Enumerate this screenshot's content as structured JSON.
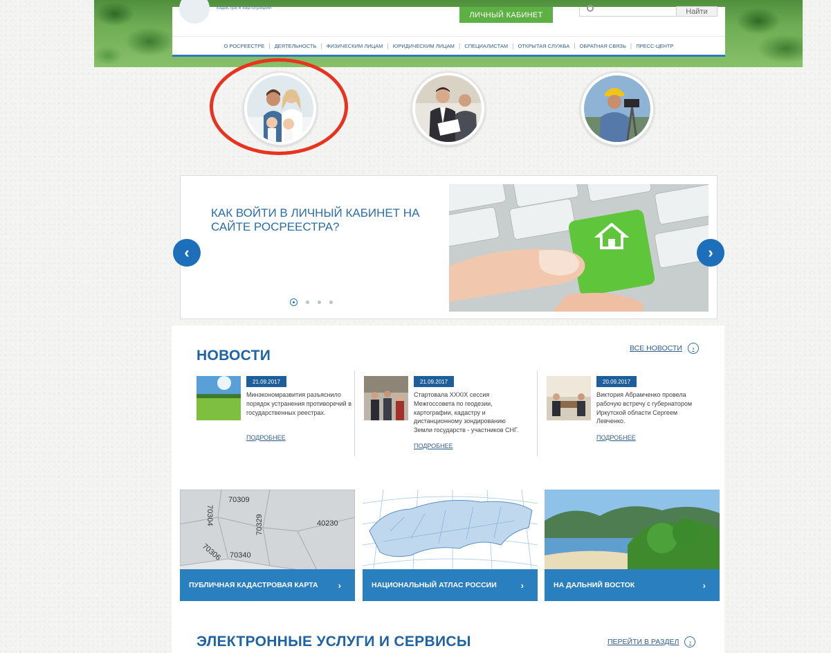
{
  "header": {
    "logo_subtitle": "кадастра и картографии",
    "cabinet_button": "ЛИЧНЫЙ КАБИНЕТ",
    "search_button": "Найти",
    "nav": [
      "О РОСРЕЕСТРЕ",
      "ДЕЯТЕЛЬНОСТЬ",
      "ФИЗИЧЕСКИМ ЛИЦАМ",
      "ЮРИДИЧЕСКИМ ЛИЦАМ",
      "СПЕЦИАЛИСТАМ",
      "ОТКРЫТАЯ СЛУЖБА",
      "ОБРАТНАЯ СВЯЗЬ",
      "ПРЕСС-ЦЕНТР"
    ]
  },
  "slider": {
    "title": "КАК ВОЙТИ В ЛИЧНЫЙ КАБИНЕТ НА САЙТЕ РОСРЕЕСТРА?",
    "prev": "‹",
    "next": "›"
  },
  "news": {
    "title": "НОВОСТИ",
    "all_link": "ВСЕ НОВОСТИ",
    "items": [
      {
        "date": "21.09.2017",
        "text": "Минэкономразвития разъяснило порядок устранения противоречий в государственных реестрах.",
        "more": "ПОДРОБНЕЕ"
      },
      {
        "date": "21.09.2017",
        "text": "Стартовала XXXIX сессия Межгоссовета по геодезии, картографии, кадастру и дистанционному зондированию Земли государств - участников СНГ.",
        "more": "ПОДРОБНЕЕ"
      },
      {
        "date": "20.09.2017",
        "text": "Виктория Абрамченко провела рабочую встречу с губернатором Иркутской области Сергеем Левченко.",
        "more": "ПОДРОБНЕЕ"
      }
    ]
  },
  "tiles": [
    {
      "label": "ПУБЛИЧНАЯ КАДАСТРОВАЯ КАРТА",
      "map_numbers": [
        "70309",
        "70304",
        "70329",
        "40230",
        "70306",
        "70340"
      ]
    },
    {
      "label": "НАЦИОНАЛЬНЫЙ АТЛАС РОССИИ"
    },
    {
      "label": "НА ДАЛЬНИЙ ВОСТОК"
    }
  ],
  "services": {
    "title": "ЭЛЕКТРОННЫЕ УСЛУГИ И СЕРВИСЫ",
    "link": "ПЕРЕЙТИ В РАЗДЕЛ"
  },
  "colors": {
    "accent_blue": "#1d6fba",
    "button_green": "#5db043",
    "annotation_red": "#e8331f"
  }
}
